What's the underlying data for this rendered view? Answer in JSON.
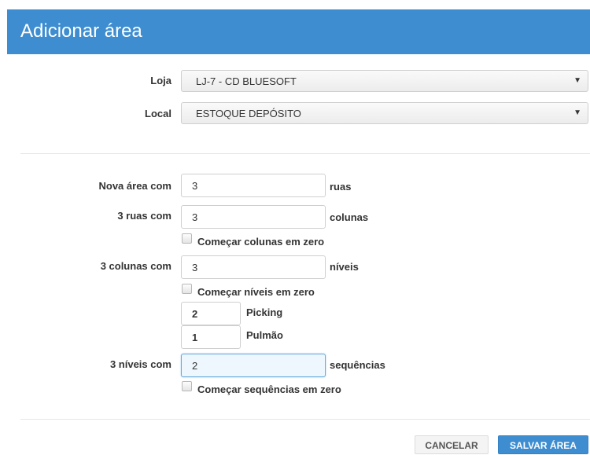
{
  "dialog": {
    "title": "Adicionar área"
  },
  "store": {
    "label": "Loja",
    "value": "LJ-7 - CD BLUESOFT"
  },
  "location": {
    "label": "Local",
    "value": "ESTOQUE DEPÓSITO"
  },
  "area": {
    "label": "Nova área com",
    "value": "3",
    "unit": "ruas"
  },
  "streets": {
    "label": "3 ruas com",
    "value": "3",
    "unit": "colunas",
    "zero_label": "Começar colunas em zero"
  },
  "columns": {
    "label": "3 colunas com",
    "value": "3",
    "unit": "níveis",
    "zero_label": "Começar níveis em zero",
    "picking_value": "2",
    "picking_label": "Picking",
    "pulmao_value": "1",
    "pulmao_label": "Pulmão"
  },
  "levels": {
    "label": "3 níveis com",
    "value": "2",
    "unit": "sequências",
    "zero_label": "Começar sequências em zero"
  },
  "footer": {
    "cancel_label": "CANCELAR",
    "save_label": "SALVAR ÁREA"
  }
}
